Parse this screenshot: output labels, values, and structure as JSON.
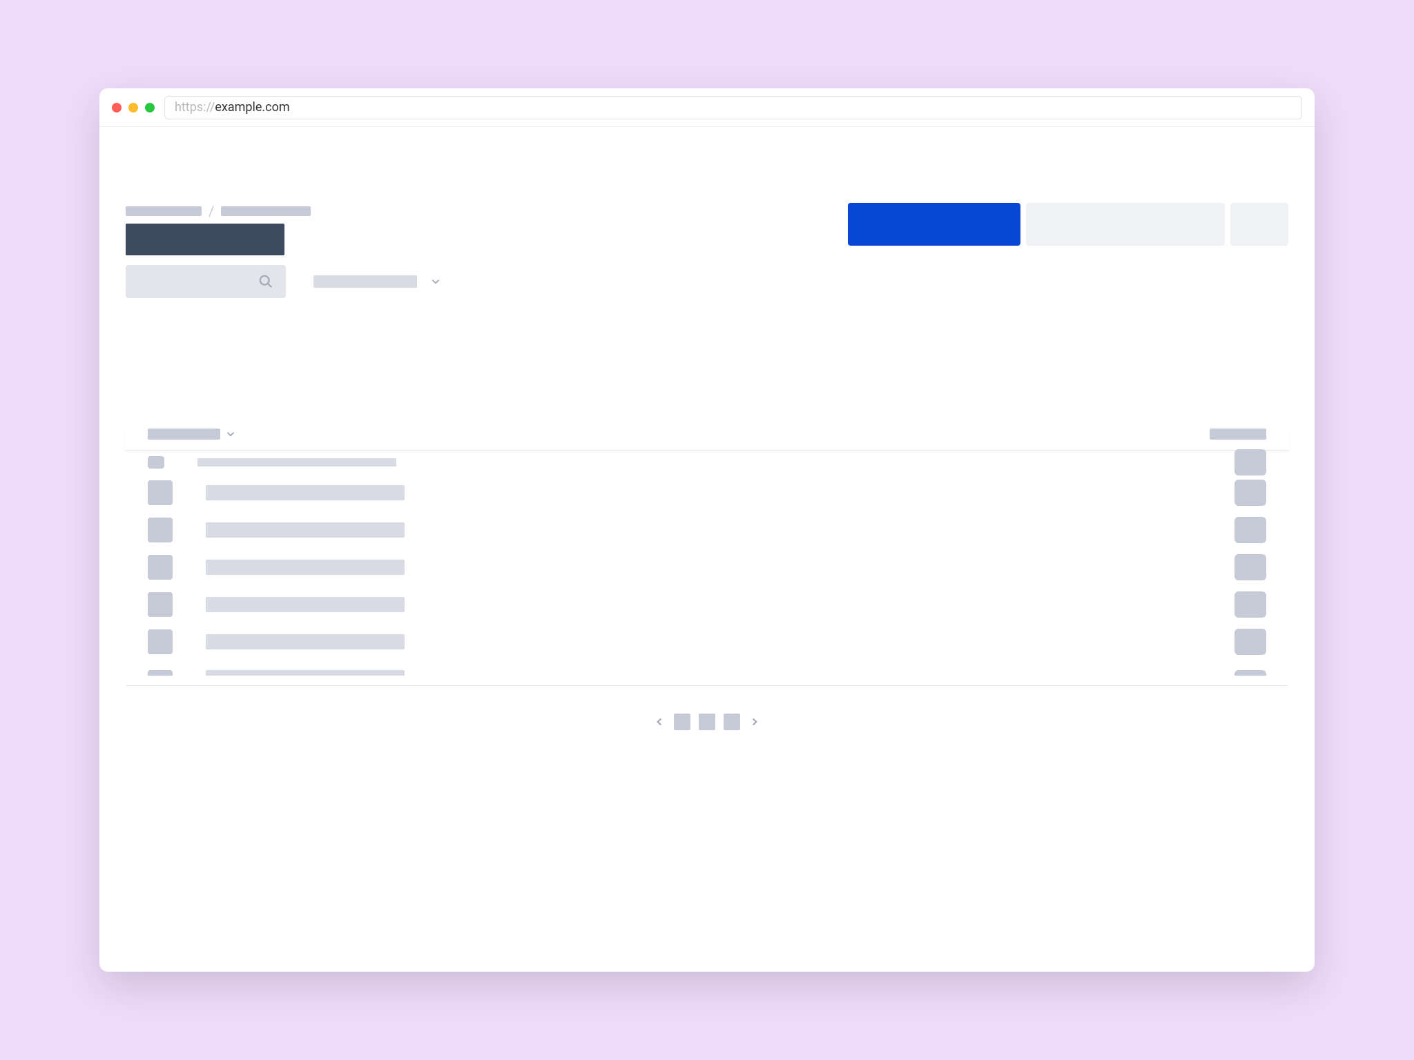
{
  "browser": {
    "url_protocol": "https://",
    "url_host": "example.com"
  },
  "breadcrumb": {
    "segment1": "",
    "divider": "/",
    "segment2": ""
  },
  "page_title": "",
  "search": {
    "placeholder": ""
  },
  "filter": {
    "label": ""
  },
  "actions": {
    "primary_label": "",
    "secondary_label": "",
    "tertiary_label": ""
  },
  "table": {
    "columns": [
      "",
      "",
      "",
      "",
      ""
    ],
    "rows": [
      {
        "c1": "",
        "c2": "",
        "c3": "",
        "c4": ""
      },
      {
        "c1": "",
        "c2": "",
        "c3": "",
        "c4": ""
      },
      {
        "c1": "",
        "c2": "",
        "c3": "",
        "c4": ""
      },
      {
        "c1": "",
        "c2": "",
        "c3": "",
        "c4": ""
      },
      {
        "c1": "",
        "c2": "",
        "c3": "",
        "c4": ""
      },
      {
        "c1": "",
        "c2": "",
        "c3": "",
        "c4": ""
      },
      {
        "c1": "",
        "c2": "",
        "c3": "",
        "c4": ""
      }
    ]
  },
  "pagination": {
    "pages": [
      "",
      "",
      ""
    ]
  },
  "colors": {
    "accent": "#0747d3",
    "title_block": "#3e4a60",
    "skeleton": "#c6cad6",
    "skeleton_light": "#d8dbe3",
    "neutral_bg": "#f0f1f5"
  }
}
